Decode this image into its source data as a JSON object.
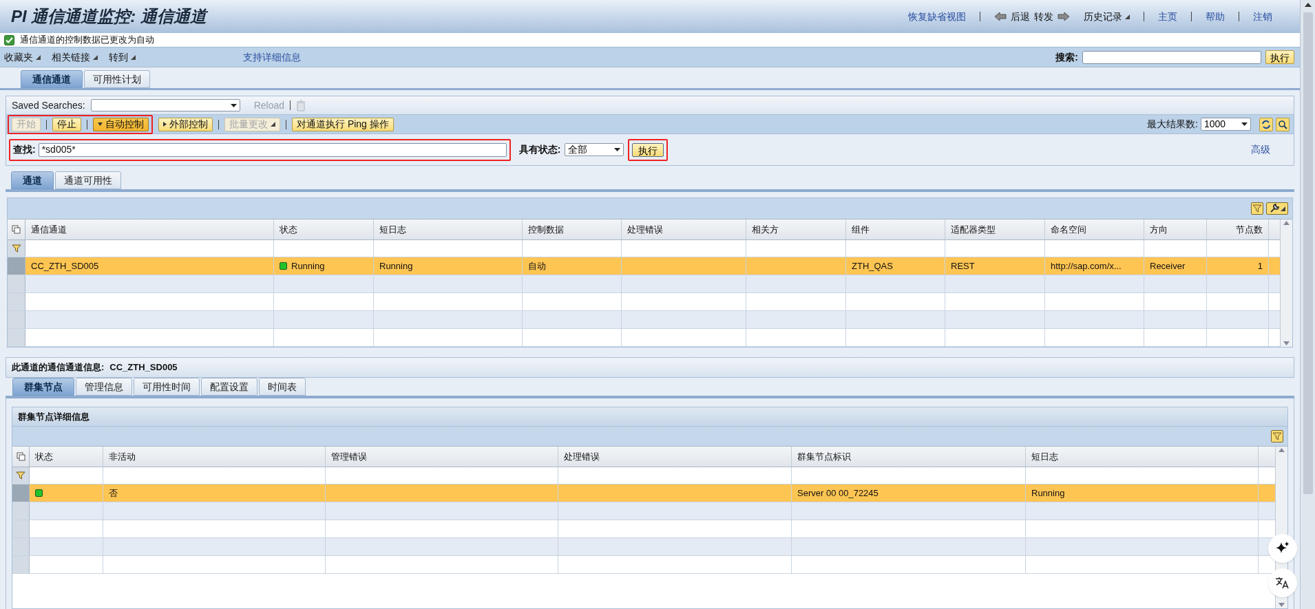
{
  "header": {
    "title": "PI 通信通道监控: 通信通道",
    "restore_view": "恢复缺省视图",
    "back": "后退",
    "forward": "转发",
    "history": "历史记录",
    "home": "主页",
    "help": "帮助",
    "logout": "注销"
  },
  "message": {
    "text": "通信通道的控制数据已更改为自动"
  },
  "menu": {
    "items": [
      "收藏夹",
      "相关链接",
      "转到"
    ],
    "support_link": "支持详细信息",
    "search_label": "搜索:",
    "search_button": "执行"
  },
  "top_tabs": [
    {
      "label": "通信通道",
      "selected": true
    },
    {
      "label": "可用性计划",
      "selected": false
    }
  ],
  "saved_searches": {
    "label": "Saved Searches:",
    "reload": "Reload"
  },
  "toolbar": {
    "buttons": [
      {
        "label": "开始",
        "kind": "plain",
        "disabled": true,
        "selected": false,
        "highlighted": true
      },
      {
        "label": "停止",
        "kind": "plain",
        "disabled": false,
        "selected": false,
        "highlighted": true
      },
      {
        "label": "自动控制",
        "kind": "dropdown",
        "disabled": false,
        "selected": true,
        "highlighted": true
      },
      {
        "label": "外部控制",
        "kind": "play",
        "disabled": false,
        "selected": false,
        "highlighted": false
      },
      {
        "label": "批量更改",
        "kind": "menu",
        "disabled": true,
        "selected": false,
        "highlighted": false
      },
      {
        "label": "对通道执行 Ping 操作",
        "kind": "plain",
        "disabled": false,
        "selected": false,
        "highlighted": false
      }
    ],
    "max_results_label": "最大结果数:",
    "max_results": "1000"
  },
  "find": {
    "label": "查找:",
    "value": "*sd005*",
    "status_label": "具有状态:",
    "status_value": "全部",
    "button": "执行",
    "advanced": "高级"
  },
  "channel_tabs": [
    {
      "label": "通道",
      "selected": true
    },
    {
      "label": "通道可用性",
      "selected": false
    }
  ],
  "channels_table": {
    "columns": [
      "通信通道",
      "状态",
      "短日志",
      "控制数据",
      "处理错误",
      "相关方",
      "组件",
      "适配器类型",
      "命名空间",
      "方向",
      "节点数"
    ],
    "rows": [
      {
        "selected": true,
        "color": "#22c32a",
        "cells": [
          "CC_ZTH_SD005",
          "Running",
          "Running",
          "自动",
          "",
          "",
          "ZTH_QAS",
          "REST",
          "http://sap.com/x...",
          "Receiver",
          "1"
        ]
      }
    ]
  },
  "details": {
    "label": "此通道的通信通道信息:",
    "channel": "CC_ZTH_SD005",
    "tabs": [
      {
        "label": "群集节点",
        "selected": true
      },
      {
        "label": "管理信息",
        "selected": false
      },
      {
        "label": "可用性时间",
        "selected": false
      },
      {
        "label": "配置设置",
        "selected": false
      },
      {
        "label": "时间表",
        "selected": false
      }
    ],
    "panel_title": "群集节点详细信息",
    "columns": [
      "状态",
      "非活动",
      "管理错误",
      "处理错误",
      "群集节点标识",
      "短日志"
    ],
    "rows": [
      {
        "selected": true,
        "color": "#22c32a",
        "cells": [
          "",
          "否",
          "",
          "",
          "Server 00 00_72245",
          "Running"
        ]
      }
    ]
  }
}
